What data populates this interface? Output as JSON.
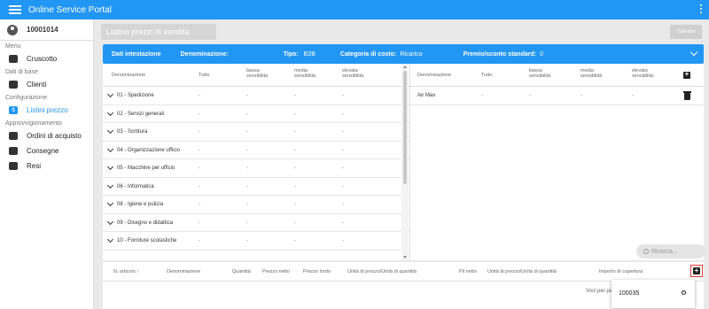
{
  "app": {
    "title": "Online Service Portal"
  },
  "sidebar": {
    "user_id": "10001014",
    "sections": [
      {
        "label": "Menu",
        "items": [
          {
            "label": "Cruscotto",
            "icon": "dashboard-icon"
          }
        ]
      },
      {
        "label": "Dati di base",
        "items": [
          {
            "label": "Clienti",
            "icon": "customers-icon"
          }
        ]
      },
      {
        "label": "Configurazione",
        "items": [
          {
            "label": "Listini prezzo",
            "icon": "pricelist-icon",
            "active": true
          }
        ]
      },
      {
        "label": "Approvvigionamento",
        "items": [
          {
            "label": "Ordini di acquisto",
            "icon": "box-icon"
          },
          {
            "label": "Consegne",
            "icon": "truck-check-icon"
          },
          {
            "label": "Resi",
            "icon": "truck-icon"
          }
        ]
      }
    ]
  },
  "header": {
    "page_title": "Listino prezzi di vendita",
    "save_label": "Salvare"
  },
  "info_bar": {
    "dati_label": "Dati intestazione",
    "denominazione_label": "Denominazione:",
    "denominazione_value": "",
    "tipo_label": "Tipo:",
    "tipo_value": "B2B",
    "categoria_label": "Categoria di costo:",
    "categoria_value": "Ricarico",
    "premio_label": "Premio/sconto standard:",
    "premio_value": "0"
  },
  "left_table": {
    "headers": [
      "Denominazione",
      "Tutto",
      "bassa sensibilità",
      "media sensibilità",
      "elevata sensibilità"
    ],
    "rows": [
      {
        "name": "01 - Spedizione",
        "vals": [
          "-",
          "-",
          "-",
          "-"
        ]
      },
      {
        "name": "02 - Servizi generali",
        "vals": [
          "-",
          "-",
          "-",
          "-"
        ]
      },
      {
        "name": "03 - Scrittura",
        "vals": [
          "-",
          "-",
          "-",
          "-"
        ]
      },
      {
        "name": "04 - Organizzazione ufficio",
        "vals": [
          "-",
          "-",
          "-",
          "-"
        ]
      },
      {
        "name": "05 - Macchine per ufficio",
        "vals": [
          "-",
          "-",
          "-",
          "-"
        ]
      },
      {
        "name": "06 - Informatica",
        "vals": [
          "-",
          "-",
          "-",
          "-"
        ]
      },
      {
        "name": "08 - Igiene e pulizia",
        "vals": [
          "-",
          "-",
          "-",
          "-"
        ]
      },
      {
        "name": "09 - Disegno e didattica",
        "vals": [
          "-",
          "-",
          "-",
          "-"
        ]
      },
      {
        "name": "10 - Forniture scolastiche",
        "vals": [
          "-",
          "-",
          "-",
          "-"
        ]
      }
    ]
  },
  "right_table": {
    "headers": [
      "Denominazione",
      "Tutto",
      "bassa sensibilità",
      "media sensibilità",
      "elevata sensibilità"
    ],
    "rows": [
      {
        "name": "Air Max",
        "vals": [
          "-",
          "-",
          "-",
          "-"
        ]
      }
    ]
  },
  "search": {
    "placeholder": "Ricerca..."
  },
  "bottom_table": {
    "headers": [
      "N. articolo",
      "Denominazione",
      "Quantità",
      "Prezzo netto",
      "Prezzo lordo",
      "Unità di prezzo/Unità di quantità",
      "Pil netto",
      "Unità di prezzo/Unità di quantità",
      "Importo di copertura"
    ],
    "per_page_label": "Voci per pagina:"
  },
  "dropdown": {
    "value": "100035"
  }
}
